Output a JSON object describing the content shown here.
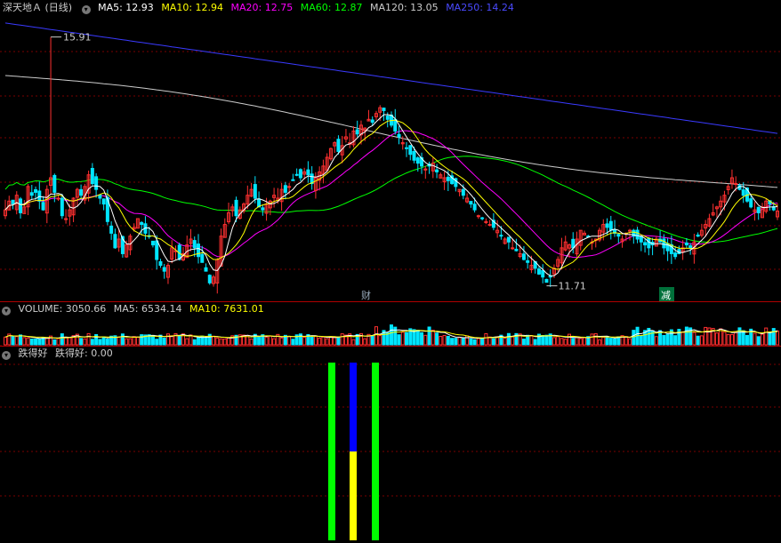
{
  "title": "深天地Ａ (日线)",
  "main_legend": [
    {
      "label": "MA5: 12.93",
      "color": "#ffffff"
    },
    {
      "label": "MA10: 12.94",
      "color": "#ffff00"
    },
    {
      "label": "MA20: 12.75",
      "color": "#ff00ff"
    },
    {
      "label": "MA60: 12.87",
      "color": "#00ff00"
    },
    {
      "label": "MA120: 13.05",
      "color": "#cccccc"
    },
    {
      "label": "MA250: 14.24",
      "color": "#4a4aff"
    }
  ],
  "volume_legend": [
    {
      "label": "VOLUME: 3050.66",
      "color": "#cccccc"
    },
    {
      "label": "MA5: 6534.14",
      "color": "#cccccc"
    },
    {
      "label": "MA10: 7631.01",
      "color": "#ffff00"
    }
  ],
  "indicator_legend": [
    {
      "label": "跌得好",
      "color": "#cccccc"
    },
    {
      "label": "跌得好: 0.00",
      "color": "#cccccc"
    }
  ],
  "annotations": {
    "high": "15.91",
    "low": "11.71",
    "marker1": "财",
    "marker2": "减"
  },
  "colors": {
    "up": "#ff3030",
    "down": "#00e5ff",
    "separator": "#b00000",
    "ma5": "#ffffff",
    "ma10": "#ffff00",
    "ma20": "#ff00ff",
    "ma60": "#00ff00",
    "ma120": "#cccccc",
    "ma250": "#3a3aff"
  },
  "chart_data": {
    "type": "candlestick",
    "price_ylim": [
      11.4,
      16.3
    ],
    "closes": [
      12.95,
      13.1,
      13.05,
      13.2,
      12.9,
      13.0,
      13.35,
      13.2,
      13.25,
      13.1,
      12.95,
      13.3,
      13.5,
      13.25,
      13.15,
      12.85,
      12.8,
      12.95,
      13.15,
      13.3,
      13.2,
      13.35,
      13.55,
      13.4,
      13.3,
      13.15,
      13.05,
      12.75,
      12.55,
      12.3,
      12.45,
      12.2,
      12.35,
      12.5,
      12.65,
      12.8,
      12.7,
      12.55,
      12.5,
      12.35,
      12.1,
      12.0,
      11.9,
      12.0,
      12.3,
      12.25,
      12.1,
      12.2,
      12.35,
      12.45,
      12.3,
      12.15,
      12.05,
      11.9,
      11.7,
      11.8,
      12.1,
      12.5,
      12.7,
      12.9,
      13.0,
      12.85,
      12.95,
      13.05,
      13.2,
      13.3,
      13.15,
      13.0,
      12.95,
      13.05,
      13.1,
      13.2,
      13.15,
      13.3,
      13.25,
      13.35,
      13.45,
      13.55,
      13.5,
      13.6,
      13.55,
      13.4,
      13.5,
      13.6,
      13.7,
      13.85,
      14.0,
      14.1,
      13.95,
      14.05,
      14.2,
      14.1,
      14.3,
      14.25,
      14.4,
      14.35,
      14.5,
      14.45,
      14.6,
      14.7,
      14.65,
      14.5,
      14.4,
      14.3,
      14.2,
      14.1,
      14.0,
      13.9,
      13.8,
      13.75,
      13.7,
      13.65,
      13.7,
      13.75,
      13.6,
      13.55,
      13.5,
      13.45,
      13.4,
      13.35,
      13.3,
      13.2,
      13.15,
      13.05,
      12.95,
      12.85,
      12.8,
      12.75,
      12.7,
      12.65,
      12.6,
      12.5,
      12.45,
      12.4,
      12.3,
      12.25,
      12.2,
      12.1,
      12.05,
      12.0,
      11.95,
      11.85,
      11.8,
      11.71,
      11.8,
      11.95,
      12.1,
      12.3,
      12.4,
      12.35,
      12.3,
      12.45,
      12.6,
      12.55,
      12.5,
      12.4,
      12.45,
      12.6,
      12.7,
      12.65,
      12.6,
      12.55,
      12.5,
      12.45,
      12.55,
      12.6,
      12.5,
      12.45,
      12.4,
      12.35,
      12.3,
      12.35,
      12.45,
      12.4,
      12.3,
      12.25,
      12.2,
      12.15,
      12.2,
      12.3,
      12.35,
      12.3,
      12.4,
      12.5,
      12.6,
      12.7,
      12.8,
      12.9,
      13.0,
      13.1,
      13.2,
      13.35,
      13.5,
      13.4,
      13.3,
      13.2,
      13.1,
      13.0,
      12.95,
      12.9,
      13.0,
      13.1,
      13.05,
      12.95,
      12.93
    ],
    "volume_ylim": [
      0,
      20000
    ],
    "indicator_bars": [
      {
        "color": "#00ff00",
        "value": 1
      },
      {
        "color": "#0000ff",
        "value": 1,
        "lower_color": "#ffff00",
        "lower_value": 0.5
      },
      {
        "color": "#00ff00",
        "value": 1
      }
    ]
  }
}
